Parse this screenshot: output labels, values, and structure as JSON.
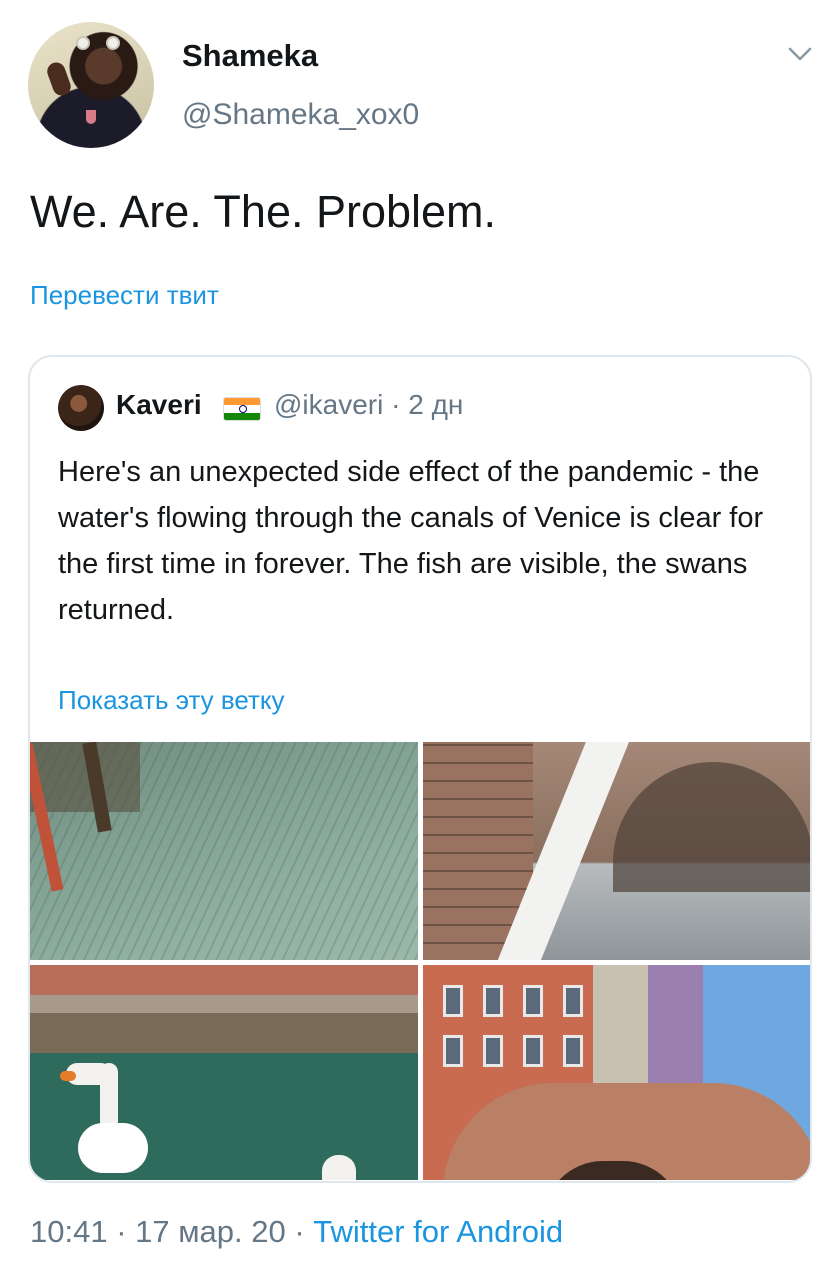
{
  "author": {
    "display_name": "Shameka",
    "handle": "@Shameka_xox0"
  },
  "tweet": {
    "text": "We. Are. The. Problem.",
    "translate_label": "Перевести твит"
  },
  "quoted": {
    "display_name": "Kaveri",
    "handle": "@ikaveri",
    "meta": "@ikaveri · 2 дн",
    "text": "Here's an unexpected side effect of the pandemic - the water's flowing through the canals of Venice is clear for the first time in forever. The fish are visible, the swans returned.",
    "show_thread_label": "Показать эту ветку",
    "images": [
      {
        "icon": "canal-fish-photo"
      },
      {
        "icon": "canal-bridge-photo"
      },
      {
        "icon": "swan-photo"
      },
      {
        "icon": "venice-bridge-photo"
      }
    ]
  },
  "footer": {
    "time_date": "10:41 · 17 мар. 20 · ",
    "source": "Twitter for Android"
  },
  "colors": {
    "link": "#1b95e0",
    "secondary_text": "#657786",
    "border": "#e1e8ed"
  }
}
